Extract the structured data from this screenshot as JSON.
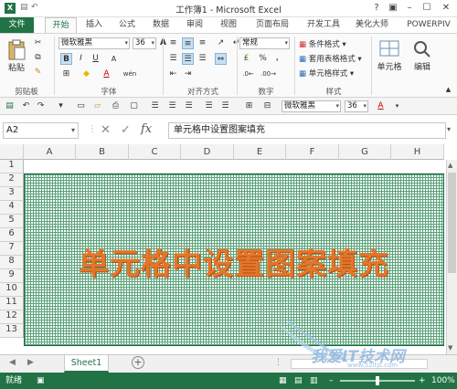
{
  "window": {
    "title": "工作簿1 - Microsoft Excel",
    "help": "?",
    "restore": "▣",
    "minimize": "–",
    "maximize": "☐",
    "close": "✕"
  },
  "tabs": [
    "文件",
    "开始",
    "插入",
    "公式",
    "数据",
    "审阅",
    "视图",
    "页面布局",
    "开发工具",
    "美化大师",
    "POWERPIV"
  ],
  "ribbon": {
    "clipboard": {
      "label": "剪贴板",
      "paste": "粘贴"
    },
    "font": {
      "label": "字体",
      "name": "微软雅黑",
      "size": "36",
      "bold": "B",
      "italic": "I",
      "underline": "U",
      "grow": "A",
      "shrink": "A",
      "font_color": "A",
      "fill_color": "◆",
      "wen": "wén"
    },
    "alignment": {
      "label": "对齐方式"
    },
    "number": {
      "label": "数字",
      "format": "常规",
      "percent": "%",
      "comma": "，",
      "currency": "₤"
    },
    "styles": {
      "label": "样式",
      "cond": "条件格式 ▾",
      "table": "套用表格格式 ▾",
      "cell": "单元格样式 ▾"
    },
    "cells": {
      "label": "单元格"
    },
    "editing": {
      "label": "编辑"
    }
  },
  "qat": {
    "font_name": "微软雅黑",
    "font_size": "36",
    "font_color": "A"
  },
  "formula_bar": {
    "name_box": "A2",
    "formula": "单元格中设置图案填充",
    "fx": "fx",
    "cancel": "✕",
    "enter": "✓"
  },
  "grid": {
    "columns": [
      "A",
      "B",
      "C",
      "D",
      "E",
      "F",
      "G",
      "H"
    ],
    "rows": [
      "1",
      "2",
      "3",
      "4",
      "5",
      "6",
      "7",
      "8",
      "9",
      "10",
      "11",
      "12",
      "13"
    ],
    "overlay_text": "单元格中设置图案填充",
    "pattern_color": "#5aa27a"
  },
  "sheets": {
    "active": "Sheet1",
    "add": "+"
  },
  "status": {
    "ready": "就绪",
    "zoom": "100%",
    "minus": "–",
    "plus": "+"
  },
  "watermark": {
    "line1": "我爱IT技术网",
    "line2": "www.52itjs.com"
  },
  "colors": {
    "accent": "#217346"
  }
}
